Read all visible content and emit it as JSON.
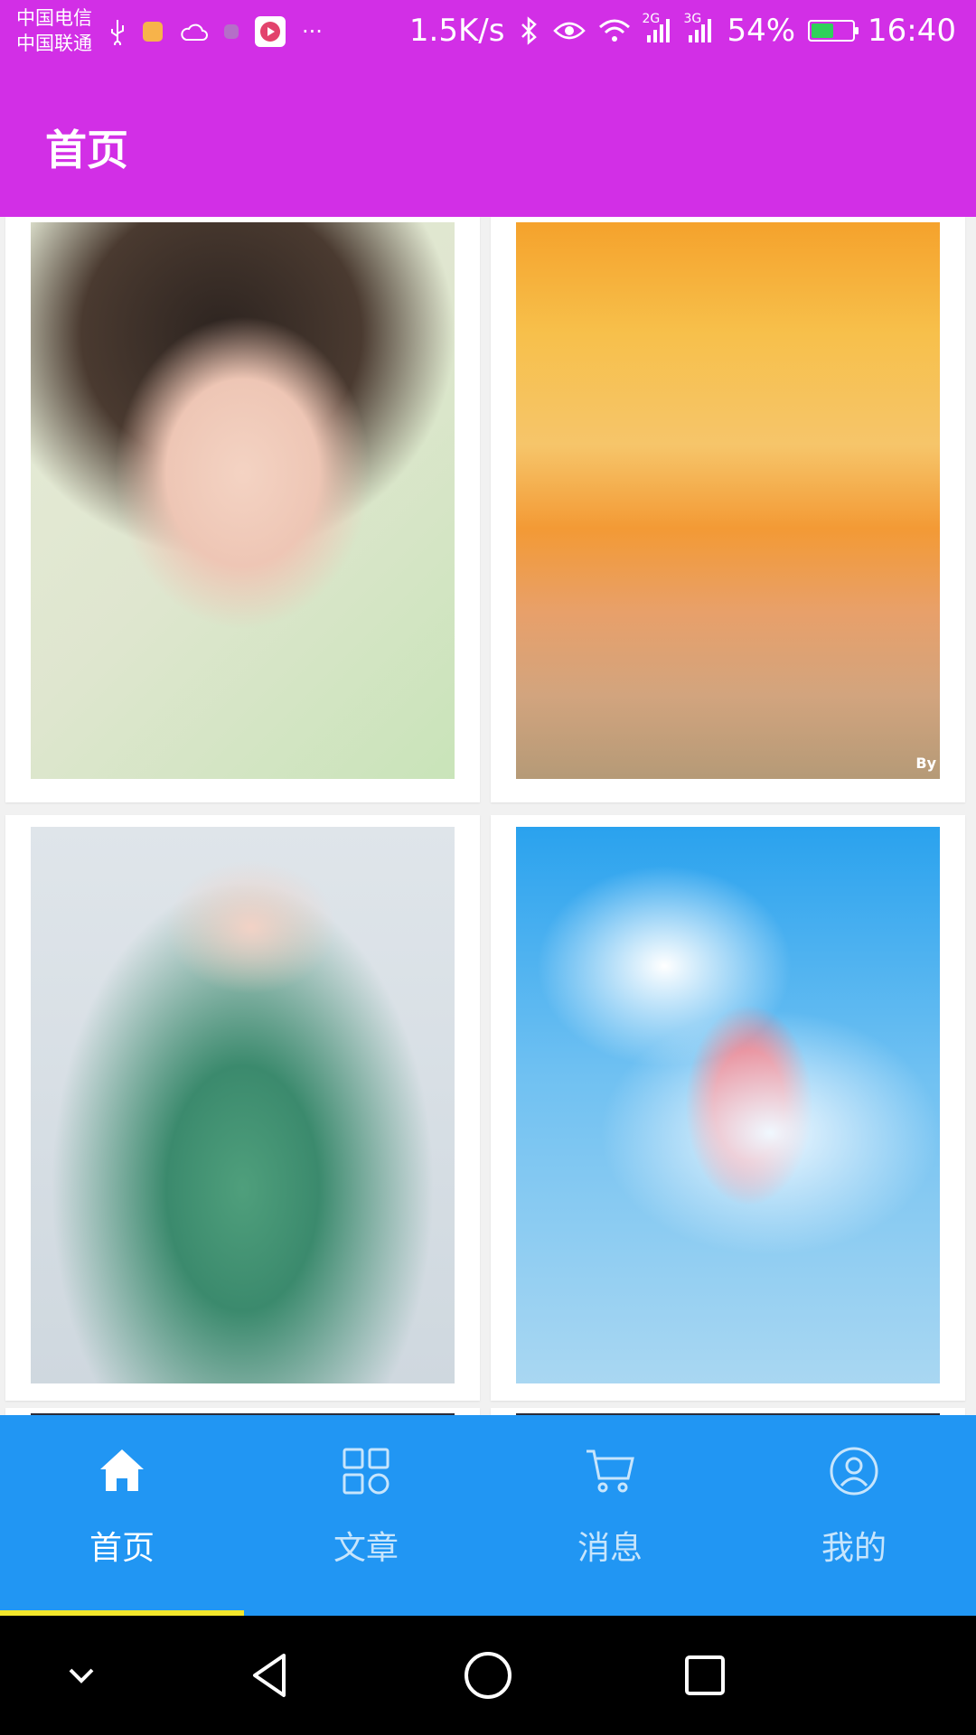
{
  "status_bar": {
    "carrier1": "中国电信",
    "carrier2": "中国联通",
    "net_speed": "1.5K/s",
    "sig1_label": "2G",
    "sig2_label": "3G",
    "battery": "54%",
    "battery_level": 0.54,
    "time": "16:40",
    "icons": [
      "usb-icon",
      "app-notif-icon",
      "cloud-icon",
      "chip-icon",
      "media-icon",
      "more-icon",
      "bluetooth-icon",
      "eye-icon",
      "wifi-icon",
      "signal-icon",
      "signal-icon",
      "battery-icon"
    ]
  },
  "app_bar": {
    "title": "首页"
  },
  "grid": {
    "items": [
      {
        "name": "girl-photo"
      },
      {
        "name": "sunset-beach-photo",
        "watermark": "By"
      },
      {
        "name": "fairy-illustration"
      },
      {
        "name": "sky-umbrella-illustration"
      },
      {
        "name": "dark-photo"
      },
      {
        "name": "dark-photo"
      }
    ]
  },
  "bottom_nav": {
    "items": [
      {
        "label": "首页",
        "icon": "home-icon",
        "active": true
      },
      {
        "label": "文章",
        "icon": "grid-icon",
        "active": false
      },
      {
        "label": "消息",
        "icon": "cart-icon",
        "active": false
      },
      {
        "label": "我的",
        "icon": "user-icon",
        "active": false
      }
    ],
    "active_color": "#ffffff",
    "indicator_color": "#f3e72b"
  },
  "colors": {
    "primary": "#d22fe6",
    "nav_bar": "#2196f3",
    "background": "#f1f1f1"
  }
}
